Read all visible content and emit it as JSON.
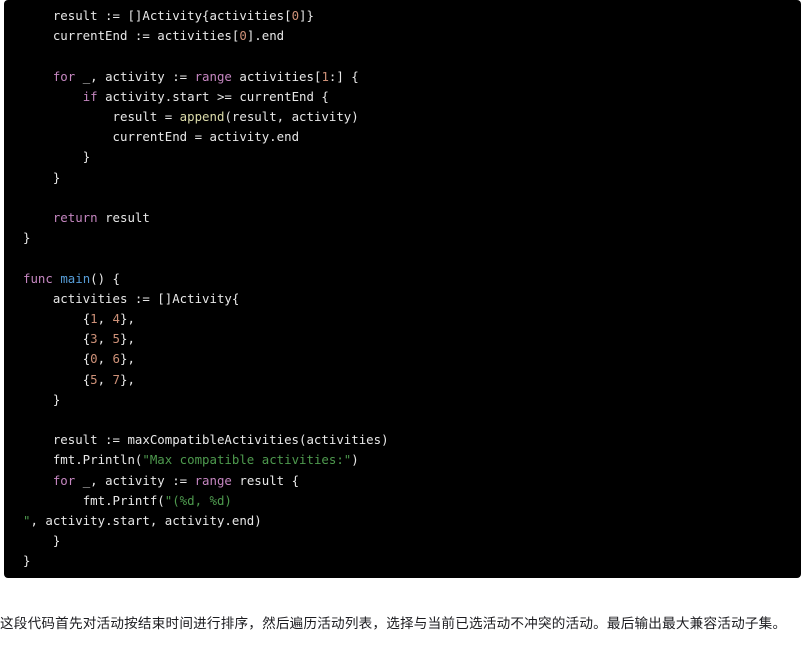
{
  "code_block": {
    "language": "go",
    "background_color": "#000000",
    "default_text_color": "#e8e8e8",
    "token_colors": {
      "keyword": "#c586c0",
      "function_name": "#569cd6",
      "builtin": "#dcdcaa",
      "number": "#ce9178",
      "string": "#4e9a4e",
      "plain": "#e8e8e8"
    },
    "lines": [
      "\tresult := []Activity{activities[0]}",
      "\tcurrentEnd := activities[0].end",
      "",
      "\tfor _, activity := range activities[1:] {",
      "\t\tif activity.start >= currentEnd {",
      "\t\t\tresult = append(result, activity)",
      "\t\t\tcurrentEnd = activity.end",
      "\t\t}",
      "\t}",
      "",
      "\treturn result",
      "}",
      "",
      "func main() {",
      "\tactivities := []Activity{",
      "\t\t{1, 4},",
      "\t\t{3, 5},",
      "\t\t{0, 6},",
      "\t\t{5, 7},",
      "\t}",
      "",
      "\tresult := maxCompatibleActivities(activities)",
      "\tfmt.Println(\"Max compatible activities:\")",
      "\tfor _, activity := range result {",
      "\t\tfmt.Printf(\"(%d, %d)",
      "\", activity.start, activity.end)",
      "\t}",
      "}"
    ],
    "activities_data": [
      [
        1,
        4
      ],
      [
        3,
        5
      ],
      [
        0,
        6
      ],
      [
        5,
        7
      ]
    ],
    "strings": [
      "Max compatible activities:",
      "(%d, %d)\\n"
    ],
    "identifiers": [
      "result",
      "currentEnd",
      "activities",
      "activity",
      "Activity",
      "maxCompatibleActivities",
      "fmt.Println",
      "fmt.Printf",
      "append",
      "range",
      "main",
      "start",
      "end"
    ]
  },
  "caption": {
    "text": "这段代码首先对活动按结束时间进行排序，然后遍历活动列表，选择与当前已选活动不冲突的活动。最后输出最大兼容活动子集。"
  }
}
